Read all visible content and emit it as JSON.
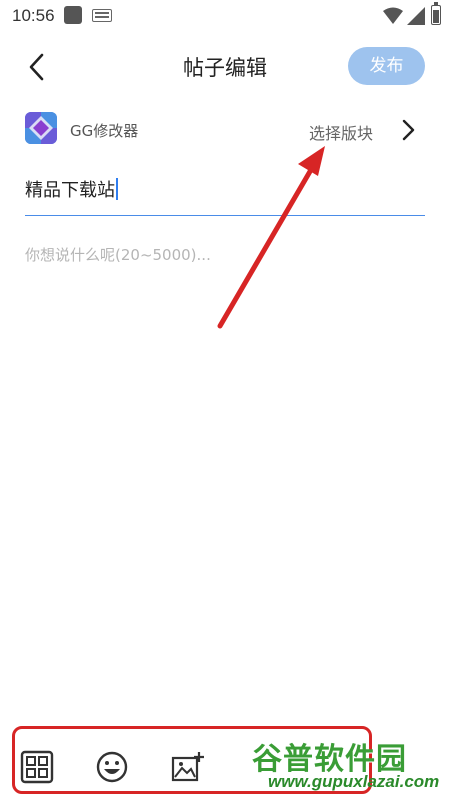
{
  "status_bar": {
    "time": "10:56",
    "icons": [
      "notification-square-icon",
      "keyboard-icon",
      "wifi-icon",
      "signal-icon",
      "battery-icon"
    ]
  },
  "header": {
    "title": "帖子编辑",
    "back_icon": "chevron-left-icon",
    "publish_label": "发布"
  },
  "app_row": {
    "app_name": "GG修改器",
    "board_label": "选择版块",
    "chevron_icon": "chevron-right-icon"
  },
  "editor": {
    "title_value": "精品下载站",
    "content_placeholder": "你想说什么呢(20~5000)..."
  },
  "toolbar": {
    "items": [
      "grid-icon",
      "emoji-icon",
      "add-image-icon"
    ]
  },
  "watermark": {
    "title": "谷普软件园",
    "url": "www.gupuxlazai.com"
  },
  "colors": {
    "accent": "#4a8ce8",
    "publish_bg": "#9ec3ee",
    "annotation": "#d72525",
    "watermark": "#3a9d36"
  }
}
